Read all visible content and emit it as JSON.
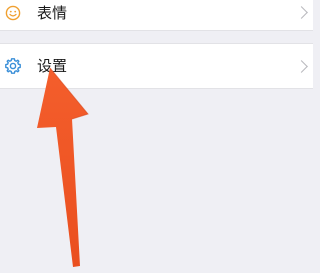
{
  "menu": {
    "items": [
      {
        "label": "表情",
        "icon": "smiley-face-icon",
        "icon_color": "#f0a030"
      },
      {
        "label": "设置",
        "icon": "gear-icon",
        "icon_color": "#3a8fd8"
      }
    ]
  },
  "annotation": {
    "arrow_color": "#f05a28",
    "points_to": "设置"
  },
  "colors": {
    "background": "#efeff4",
    "row_background": "#ffffff",
    "chevron": "#b8b8bd"
  }
}
